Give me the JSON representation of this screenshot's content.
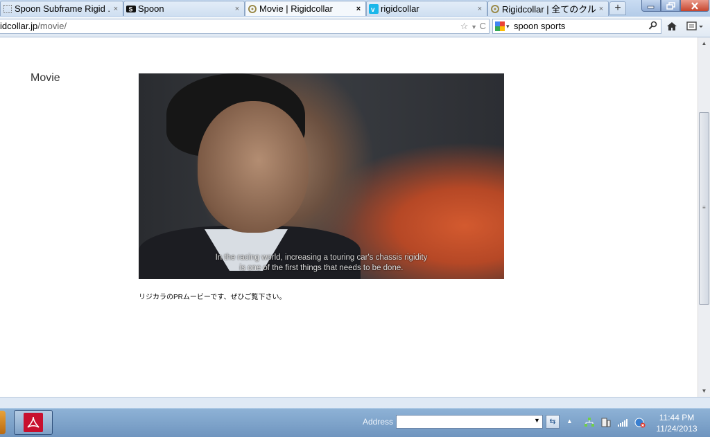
{
  "tabs": [
    {
      "label": "Spoon Subframe Rigid ...",
      "icon": "dotted-page-icon"
    },
    {
      "label": "Spoon",
      "icon": "spoon-logo-icon"
    },
    {
      "label": "Movie | Rigidcollar",
      "icon": "rigidcollar-favicon",
      "active": true
    },
    {
      "label": "rigidcollar",
      "icon": "vimeo-icon"
    },
    {
      "label": "Rigidcollar | 全てのクル...",
      "icon": "rigidcollar-favicon"
    }
  ],
  "tab_close_glyph": "×",
  "new_tab_glyph": "+",
  "url": {
    "host": "idcollar.jp",
    "path": "/movie/"
  },
  "search": {
    "engine_icon": "google-icon",
    "value": "spoon sports"
  },
  "page": {
    "heading": "Movie",
    "video_subtitle_line1": "In the racing world, increasing a touring car's chassis rigidity",
    "video_subtitle_line2": "is one of the first things that needs to be done.",
    "caption": "リジカラのPRムービーです、ぜひご覧下さい。"
  },
  "taskbar": {
    "address_label": "Address",
    "address_value": "",
    "clock_time": "11:44 PM",
    "clock_date": "11/24/2013"
  },
  "colors": {
    "accent": "#c8102e",
    "taskbar": "#7fa4cb"
  }
}
